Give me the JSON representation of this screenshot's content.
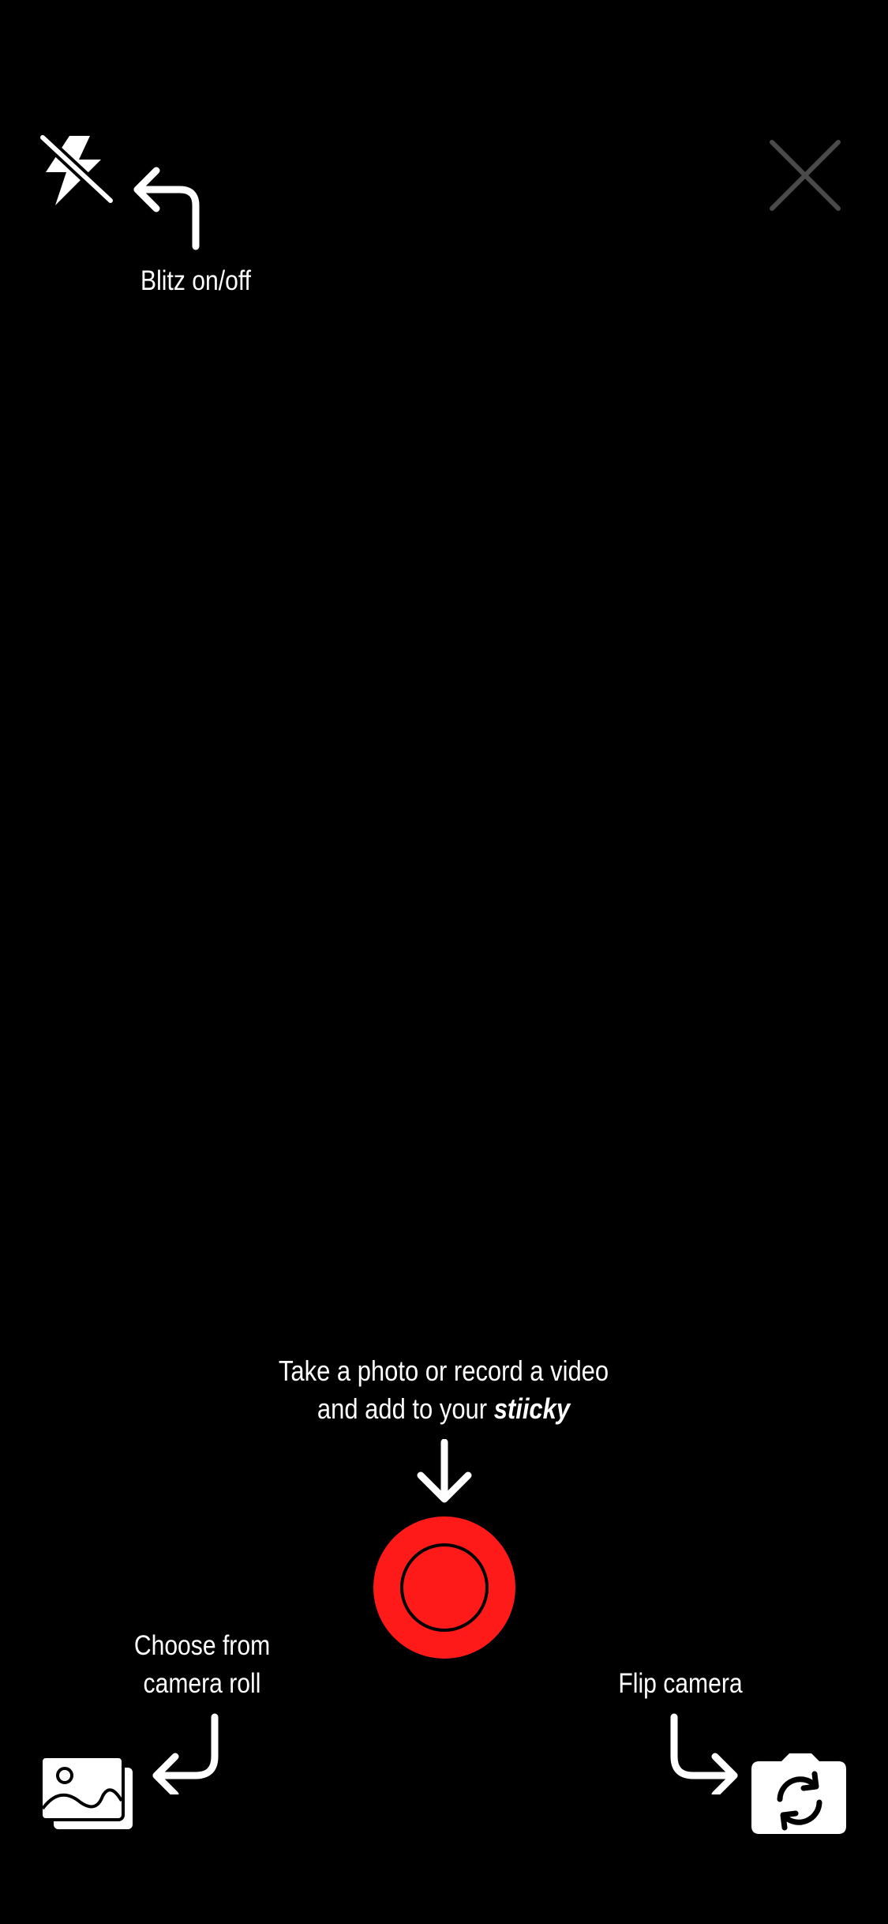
{
  "hints": {
    "flash": "Blitz on/off",
    "capture_line1": "Take a photo or record a video",
    "capture_line2_prefix": "and add to your ",
    "brand": "stiicky",
    "gallery_line1": "Choose from",
    "gallery_line2": "camera roll",
    "flip": "Flip camera"
  },
  "icons": {
    "flash": "flash-off-icon",
    "close": "close-icon",
    "gallery": "gallery-icon",
    "flip": "flip-camera-icon",
    "shutter": "shutter-record-icon"
  },
  "colors": {
    "background": "#000000",
    "shutter": "#ff1a1a",
    "close": "#4a4a4a",
    "text": "#ffffff"
  }
}
